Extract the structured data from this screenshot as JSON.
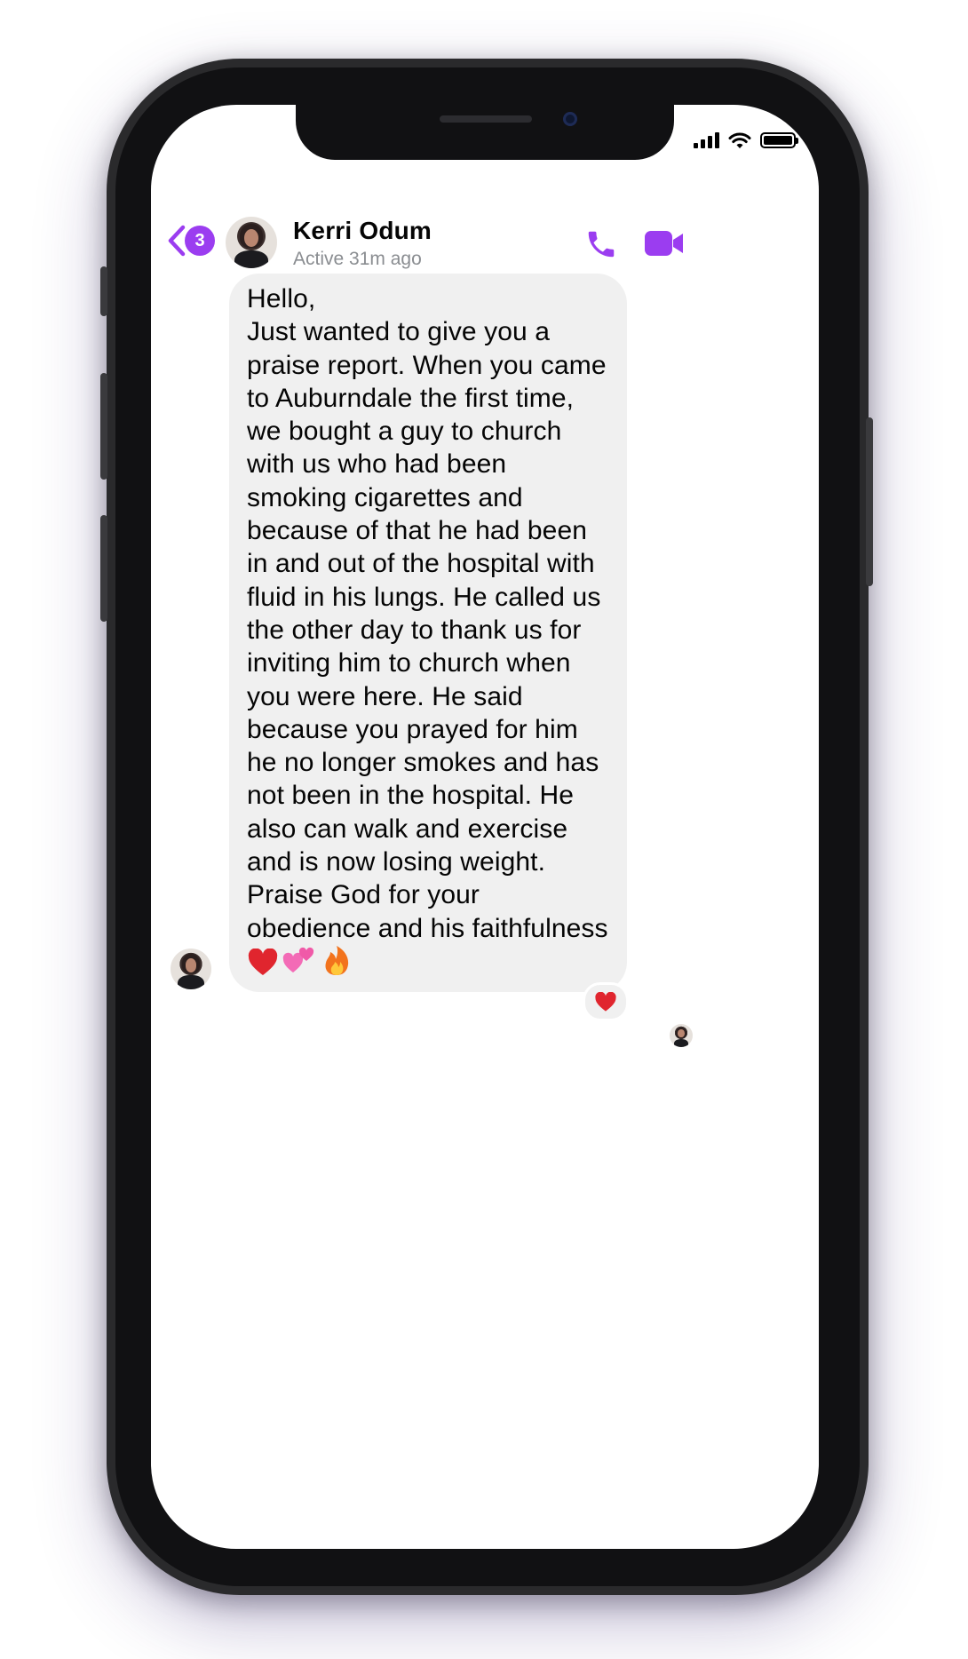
{
  "header": {
    "unread_count": "3",
    "contact_name": "Kerri Odum",
    "contact_status": "Active 31m ago"
  },
  "message": {
    "text": "Hello,\nJust wanted to give you a praise report. When you came to Auburndale the first time, we bought a guy to church with us who had been smoking cigarettes and because of that he had been in and out of the hospital with fluid in his lungs. He called us the other day to thank us for inviting him to church when you were here. He said because you prayed for him he no longer smokes and has not been in the hospital. He also can walk and exercise and is now losing weight. Praise God for your obedience and his faithfulness",
    "trailing_emojis": [
      "red-heart",
      "two-hearts",
      "fire"
    ],
    "reaction": "red-heart"
  },
  "colors": {
    "accent": "#9b3df0",
    "bubble_bg": "#f0f0f0",
    "secondary_text": "#8a8d91"
  },
  "icons": [
    "back-chevron-icon",
    "phone-icon",
    "video-camera-icon",
    "signal-icon",
    "wifi-icon",
    "battery-icon"
  ]
}
